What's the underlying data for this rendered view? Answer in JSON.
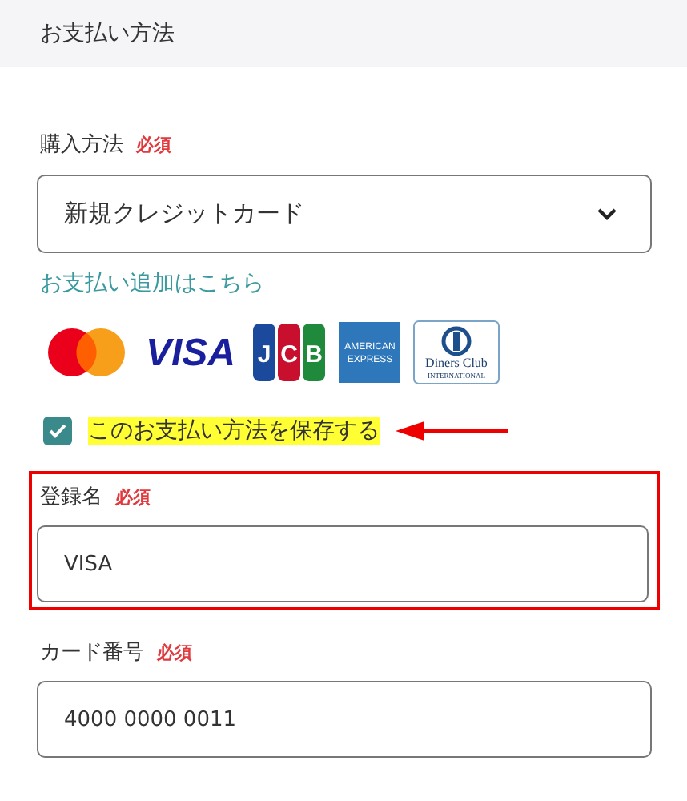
{
  "header": {
    "title": "お支払い方法"
  },
  "purchase_method": {
    "label": "購入方法",
    "badge": "必須",
    "value": "新規クレジットカード"
  },
  "add_payment_link": "お支払い追加はこちら",
  "card_brands": [
    {
      "kind": "mastercard"
    },
    {
      "kind": "visa",
      "lines": [
        "VISA"
      ]
    },
    {
      "kind": "jcb",
      "lines": [
        "J",
        "C",
        "B"
      ]
    },
    {
      "kind": "amex",
      "lines": [
        "AMERICAN",
        "EXPRESS"
      ]
    },
    {
      "kind": "diners",
      "lines": [
        "Diners Club",
        "INTERNATIONAL"
      ]
    }
  ],
  "save_option": {
    "label": "このお支払い方法を保存する",
    "checked": true,
    "highlighted": true,
    "arrow": true
  },
  "fields": [
    {
      "label": "登録名",
      "badge": "必須",
      "value": "VISA",
      "outlined": true
    },
    {
      "label": "カード番号",
      "badge": "必須",
      "value": "4000 0000 0011",
      "outlined": false
    }
  ]
}
